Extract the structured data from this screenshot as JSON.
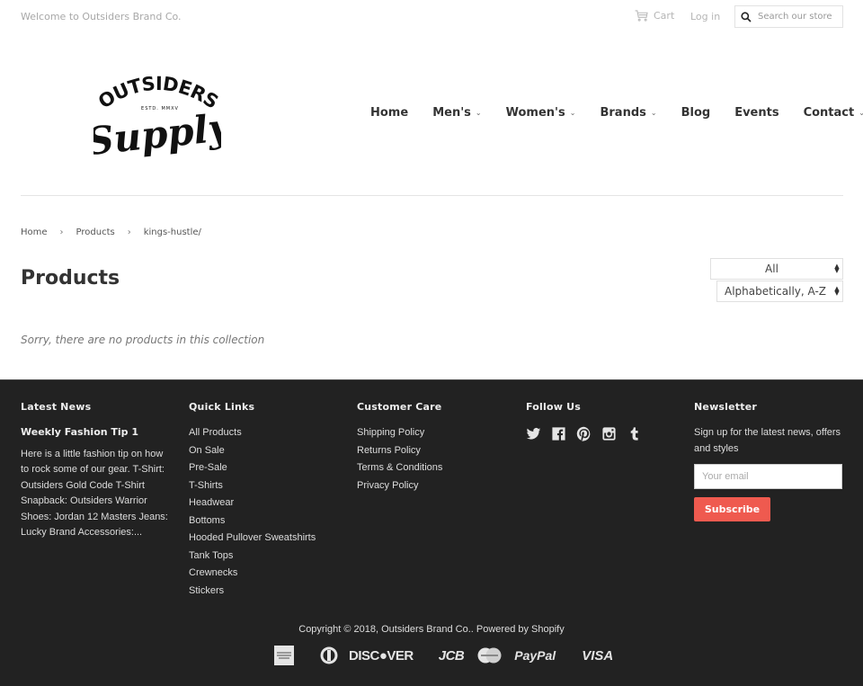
{
  "topbar": {
    "welcome": "Welcome to Outsiders Brand Co.",
    "cart_label": "Cart",
    "login_label": "Log in",
    "search_placeholder": "Search our store",
    "search_value": ""
  },
  "logo": {
    "line1": "OUTSIDERS",
    "tagline": "ESTD. MMXV",
    "line2": "Supply"
  },
  "nav": {
    "items": [
      {
        "label": "Home",
        "dropdown": false
      },
      {
        "label": "Men's",
        "dropdown": true
      },
      {
        "label": "Women's",
        "dropdown": true
      },
      {
        "label": "Brands",
        "dropdown": true
      },
      {
        "label": "Blog",
        "dropdown": false
      },
      {
        "label": "Events",
        "dropdown": false
      },
      {
        "label": "Contact",
        "dropdown": true
      }
    ]
  },
  "breadcrumb": {
    "items": [
      "Home",
      "Products",
      "kings-hustle/"
    ],
    "separator": "›"
  },
  "main": {
    "title": "Products",
    "filter_selected": "All",
    "sort_selected": "Alphabetically, A-Z",
    "empty_message": "Sorry, there are no products in this collection"
  },
  "footer": {
    "latest_news": {
      "heading": "Latest News",
      "post_title": "Weekly Fashion Tip 1",
      "excerpt": "Here is a little fashion tip on how to rock some of our gear. T-Shirt: Outsiders Gold Code T-Shirt Snapback: Outsiders Warrior Shoes: Jordan 12 Masters Jeans: Lucky Brand  Accessories:..."
    },
    "quick_links": {
      "heading": "Quick Links",
      "items": [
        "All Products",
        "On Sale",
        "Pre-Sale",
        "T-Shirts",
        "Headwear",
        "Bottoms",
        "Hooded Pullover Sweatshirts",
        "Tank Tops",
        "Crewnecks",
        "Stickers"
      ]
    },
    "customer_care": {
      "heading": "Customer Care",
      "items": [
        "Shipping Policy",
        "Returns Policy",
        "Terms & Conditions",
        "Privacy Policy"
      ]
    },
    "follow_us": {
      "heading": "Follow Us",
      "icons": [
        "twitter-icon",
        "facebook-icon",
        "pinterest-icon",
        "instagram-icon",
        "tumblr-icon"
      ]
    },
    "newsletter": {
      "heading": "Newsletter",
      "text": "Sign up for the latest news, offers and styles",
      "email_placeholder": "Your email",
      "email_value": "",
      "button_label": "Subscribe"
    },
    "copyright": "Copyright © 2018, Outsiders Brand Co.. Powered by Shopify",
    "payments": {
      "discover": "DISC●VER",
      "jcb": "JCB",
      "paypal": "PayPal",
      "visa": "VISA"
    }
  },
  "colors": {
    "footer_bg": "#222222",
    "accent_button": "#ef5a4f",
    "text_dark": "#333333"
  }
}
